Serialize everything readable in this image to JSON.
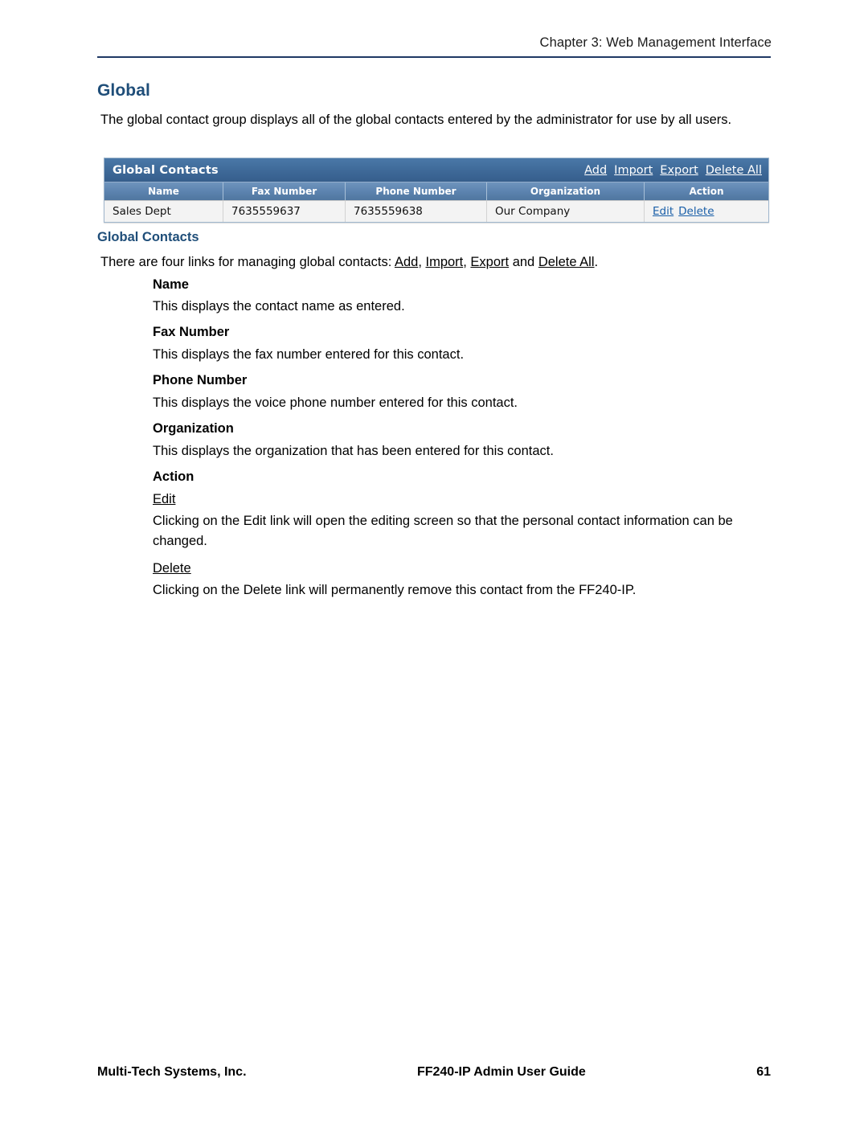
{
  "header": {
    "chapter": "Chapter 3: Web Management Interface"
  },
  "headings": {
    "h1": "Global",
    "global_contacts": "Global Contacts",
    "name": "Name",
    "fax_number": "Fax Number",
    "phone_number": "Phone Number",
    "organization": "Organization",
    "action": "Action"
  },
  "paragraphs": {
    "intro": "The global contact group displays all of the global contacts entered by the administrator for use by all users.",
    "four_links_prefix": "There are four links for managing global contacts: ",
    "four_links_add": "Add",
    "four_links_sep1": ", ",
    "four_links_import": "Import",
    "four_links_sep2": ", ",
    "four_links_export": "Export",
    "four_links_sep3": " and ",
    "four_links_delete_all": "Delete All",
    "four_links_suffix": ".",
    "name_desc": "This displays the contact name as entered.",
    "fax_desc": "This displays the fax number entered for this contact.",
    "phone_desc": "This displays the voice phone number entered for this contact.",
    "org_desc": "This displays the organization that has been entered for this contact.",
    "edit_label": "Edit",
    "edit_desc": "Clicking on the Edit link will open the editing screen so that the personal contact information can be changed.",
    "delete_label": "Delete",
    "delete_desc": "Clicking on the Delete link will permanently remove this contact from the FF240-IP."
  },
  "screenshot": {
    "title": "Global Contacts",
    "toolbar_links": [
      "Add",
      "Import",
      "Export",
      "Delete All"
    ],
    "columns": [
      "Name",
      "Fax Number",
      "Phone Number",
      "Organization",
      "Action"
    ],
    "rows": [
      {
        "name": "Sales Dept",
        "fax": "7635559637",
        "phone": "7635559638",
        "organization": "Our Company",
        "actions": [
          "Edit",
          "Delete"
        ]
      }
    ]
  },
  "footer": {
    "left": "Multi-Tech Systems, Inc.",
    "center": "FF240-IP Admin User Guide",
    "right": "61"
  }
}
